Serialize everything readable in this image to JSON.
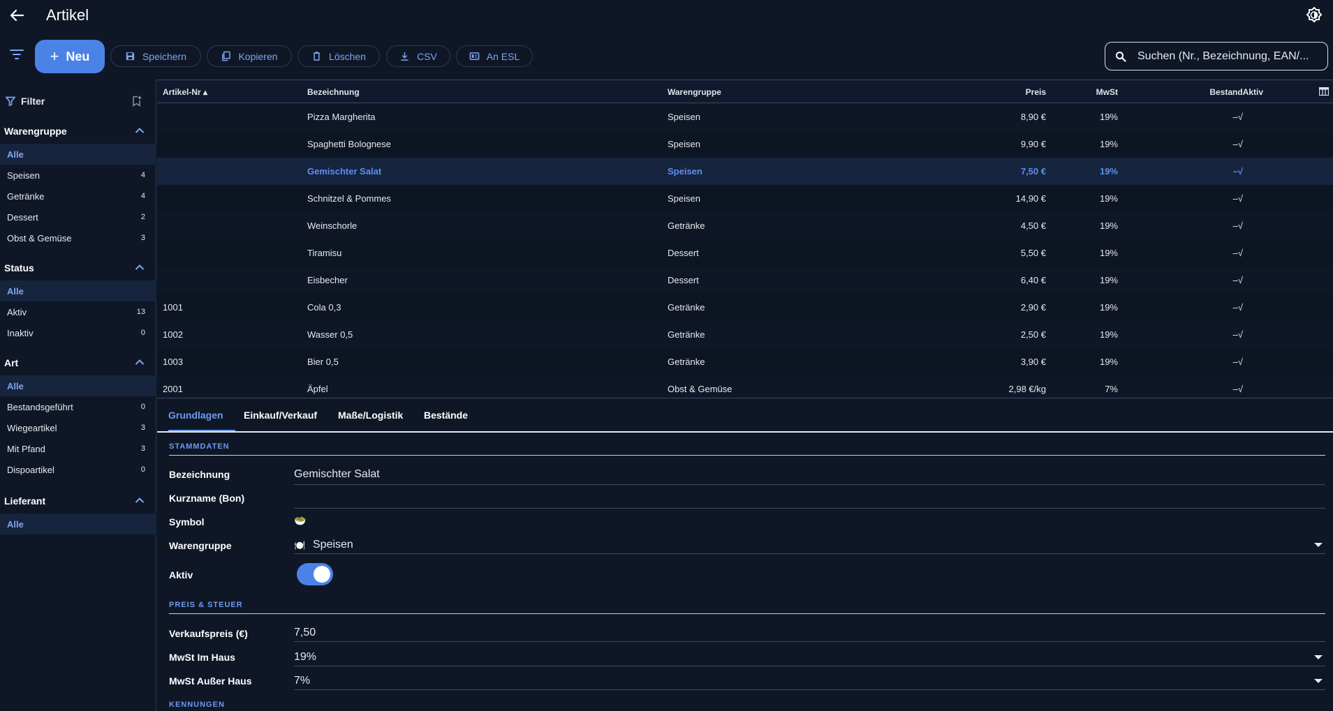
{
  "header": {
    "title": "Artikel"
  },
  "toolbar": {
    "new_label": "Neu",
    "save_label": "Speichern",
    "copy_label": "Kopieren",
    "delete_label": "Löschen",
    "csv_label": "CSV",
    "esl_label": "An ESL",
    "search_placeholder": "Suchen (Nr., Bezeichnung, EAN/..."
  },
  "sidebar": {
    "filter_label": "Filter",
    "groups": [
      {
        "title": "Warengruppe",
        "items": [
          {
            "label": "Alle",
            "count": ""
          },
          {
            "label": "Speisen",
            "count": "4"
          },
          {
            "label": "Getränke",
            "count": "4"
          },
          {
            "label": "Dessert",
            "count": "2"
          },
          {
            "label": "Obst & Gemüse",
            "count": "3"
          }
        ]
      },
      {
        "title": "Status",
        "items": [
          {
            "label": "Alle",
            "count": ""
          },
          {
            "label": "Aktiv",
            "count": "13"
          },
          {
            "label": "Inaktiv",
            "count": "0"
          }
        ]
      },
      {
        "title": "Art",
        "items": [
          {
            "label": "Alle",
            "count": ""
          },
          {
            "label": "Bestandsgeführt",
            "count": "0"
          },
          {
            "label": "Wiegeartikel",
            "count": "3"
          },
          {
            "label": "Mit Pfand",
            "count": "3"
          },
          {
            "label": "Dispoartikel",
            "count": "0"
          }
        ]
      },
      {
        "title": "Lieferant",
        "items": [
          {
            "label": "Alle",
            "count": ""
          }
        ]
      }
    ]
  },
  "table": {
    "columns": {
      "nr": "Artikel-Nr",
      "name": "Bezeichnung",
      "group": "Warengruppe",
      "price": "Preis",
      "vat": "MwSt",
      "stock": "BestandAktiv"
    },
    "rows": [
      {
        "nr": "",
        "name": "Pizza Margherita",
        "group": "Speisen",
        "price": "8,90 €",
        "vat": "19%",
        "stock": "–√"
      },
      {
        "nr": "",
        "name": "Spaghetti Bolognese",
        "group": "Speisen",
        "price": "9,90 €",
        "vat": "19%",
        "stock": "–√"
      },
      {
        "nr": "",
        "name": "Gemischter Salat",
        "group": "Speisen",
        "price": "7,50 €",
        "vat": "19%",
        "stock": "–√"
      },
      {
        "nr": "",
        "name": "Schnitzel & Pommes",
        "group": "Speisen",
        "price": "14,90 €",
        "vat": "19%",
        "stock": "–√"
      },
      {
        "nr": "",
        "name": "Weinschorle",
        "group": "Getränke",
        "price": "4,50 €",
        "vat": "19%",
        "stock": "–√"
      },
      {
        "nr": "",
        "name": "Tiramisu",
        "group": "Dessert",
        "price": "5,50 €",
        "vat": "19%",
        "stock": "–√"
      },
      {
        "nr": "",
        "name": "Eisbecher",
        "group": "Dessert",
        "price": "6,40 €",
        "vat": "19%",
        "stock": "–√"
      },
      {
        "nr": "1001",
        "name": "Cola 0,3",
        "group": "Getränke",
        "price": "2,90 €",
        "vat": "19%",
        "stock": "–√"
      },
      {
        "nr": "1002",
        "name": "Wasser 0,5",
        "group": "Getränke",
        "price": "2,50 €",
        "vat": "19%",
        "stock": "–√"
      },
      {
        "nr": "1003",
        "name": "Bier 0,5",
        "group": "Getränke",
        "price": "3,90 €",
        "vat": "19%",
        "stock": "–√"
      },
      {
        "nr": "2001",
        "name": "Äpfel",
        "group": "Obst & Gemüse",
        "price": "2,98 €/kg",
        "vat": "7%",
        "stock": "–√"
      }
    ]
  },
  "detail": {
    "tabs": [
      "Grundlagen",
      "Einkauf/Verkauf",
      "Maße/Logistik",
      "Bestände"
    ],
    "sections": {
      "stammdaten": "STAMMDATEN",
      "preis": "PREIS & STEUER",
      "kennungen": "KENNUNGEN"
    },
    "fields": {
      "bezeichnung_label": "Bezeichnung",
      "bezeichnung_value": "Gemischter Salat",
      "kurzname_label": "Kurzname (Bon)",
      "kurzname_value": "",
      "symbol_label": "Symbol",
      "symbol_value": "🥗",
      "warengruppe_label": "Warengruppe",
      "warengruppe_icon": "🍽️",
      "warengruppe_value": "Speisen",
      "aktiv_label": "Aktiv",
      "aktiv_on": true,
      "verkaufspreis_label": "Verkaufspreis (€)",
      "verkaufspreis_value": "7,50",
      "mwst_haus_label": "MwSt Im Haus",
      "mwst_haus_value": "19%",
      "mwst_ausser_label": "MwSt Außer Haus",
      "mwst_ausser_value": "7%"
    }
  },
  "colors": {
    "accent": "#4b82e6",
    "background": "#0f1727",
    "selection": "#17243d"
  }
}
